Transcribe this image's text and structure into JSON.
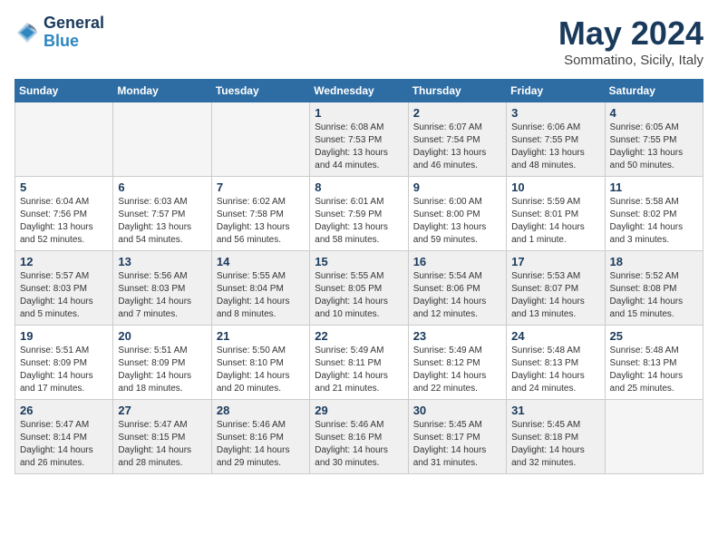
{
  "logo": {
    "line1": "General",
    "line2": "Blue"
  },
  "title": "May 2024",
  "subtitle": "Sommatino, Sicily, Italy",
  "days_of_week": [
    "Sunday",
    "Monday",
    "Tuesday",
    "Wednesday",
    "Thursday",
    "Friday",
    "Saturday"
  ],
  "weeks": [
    [
      {
        "day": "",
        "empty": true
      },
      {
        "day": "",
        "empty": true
      },
      {
        "day": "",
        "empty": true
      },
      {
        "day": "1",
        "sunrise": "6:08 AM",
        "sunset": "7:53 PM",
        "daylight": "13 hours and 44 minutes."
      },
      {
        "day": "2",
        "sunrise": "6:07 AM",
        "sunset": "7:54 PM",
        "daylight": "13 hours and 46 minutes."
      },
      {
        "day": "3",
        "sunrise": "6:06 AM",
        "sunset": "7:55 PM",
        "daylight": "13 hours and 48 minutes."
      },
      {
        "day": "4",
        "sunrise": "6:05 AM",
        "sunset": "7:55 PM",
        "daylight": "13 hours and 50 minutes."
      }
    ],
    [
      {
        "day": "5",
        "sunrise": "6:04 AM",
        "sunset": "7:56 PM",
        "daylight": "13 hours and 52 minutes."
      },
      {
        "day": "6",
        "sunrise": "6:03 AM",
        "sunset": "7:57 PM",
        "daylight": "13 hours and 54 minutes."
      },
      {
        "day": "7",
        "sunrise": "6:02 AM",
        "sunset": "7:58 PM",
        "daylight": "13 hours and 56 minutes."
      },
      {
        "day": "8",
        "sunrise": "6:01 AM",
        "sunset": "7:59 PM",
        "daylight": "13 hours and 58 minutes."
      },
      {
        "day": "9",
        "sunrise": "6:00 AM",
        "sunset": "8:00 PM",
        "daylight": "13 hours and 59 minutes."
      },
      {
        "day": "10",
        "sunrise": "5:59 AM",
        "sunset": "8:01 PM",
        "daylight": "14 hours and 1 minute."
      },
      {
        "day": "11",
        "sunrise": "5:58 AM",
        "sunset": "8:02 PM",
        "daylight": "14 hours and 3 minutes."
      }
    ],
    [
      {
        "day": "12",
        "sunrise": "5:57 AM",
        "sunset": "8:03 PM",
        "daylight": "14 hours and 5 minutes."
      },
      {
        "day": "13",
        "sunrise": "5:56 AM",
        "sunset": "8:03 PM",
        "daylight": "14 hours and 7 minutes."
      },
      {
        "day": "14",
        "sunrise": "5:55 AM",
        "sunset": "8:04 PM",
        "daylight": "14 hours and 8 minutes."
      },
      {
        "day": "15",
        "sunrise": "5:55 AM",
        "sunset": "8:05 PM",
        "daylight": "14 hours and 10 minutes."
      },
      {
        "day": "16",
        "sunrise": "5:54 AM",
        "sunset": "8:06 PM",
        "daylight": "14 hours and 12 minutes."
      },
      {
        "day": "17",
        "sunrise": "5:53 AM",
        "sunset": "8:07 PM",
        "daylight": "14 hours and 13 minutes."
      },
      {
        "day": "18",
        "sunrise": "5:52 AM",
        "sunset": "8:08 PM",
        "daylight": "14 hours and 15 minutes."
      }
    ],
    [
      {
        "day": "19",
        "sunrise": "5:51 AM",
        "sunset": "8:09 PM",
        "daylight": "14 hours and 17 minutes."
      },
      {
        "day": "20",
        "sunrise": "5:51 AM",
        "sunset": "8:09 PM",
        "daylight": "14 hours and 18 minutes."
      },
      {
        "day": "21",
        "sunrise": "5:50 AM",
        "sunset": "8:10 PM",
        "daylight": "14 hours and 20 minutes."
      },
      {
        "day": "22",
        "sunrise": "5:49 AM",
        "sunset": "8:11 PM",
        "daylight": "14 hours and 21 minutes."
      },
      {
        "day": "23",
        "sunrise": "5:49 AM",
        "sunset": "8:12 PM",
        "daylight": "14 hours and 22 minutes."
      },
      {
        "day": "24",
        "sunrise": "5:48 AM",
        "sunset": "8:13 PM",
        "daylight": "14 hours and 24 minutes."
      },
      {
        "day": "25",
        "sunrise": "5:48 AM",
        "sunset": "8:13 PM",
        "daylight": "14 hours and 25 minutes."
      }
    ],
    [
      {
        "day": "26",
        "sunrise": "5:47 AM",
        "sunset": "8:14 PM",
        "daylight": "14 hours and 26 minutes."
      },
      {
        "day": "27",
        "sunrise": "5:47 AM",
        "sunset": "8:15 PM",
        "daylight": "14 hours and 28 minutes."
      },
      {
        "day": "28",
        "sunrise": "5:46 AM",
        "sunset": "8:16 PM",
        "daylight": "14 hours and 29 minutes."
      },
      {
        "day": "29",
        "sunrise": "5:46 AM",
        "sunset": "8:16 PM",
        "daylight": "14 hours and 30 minutes."
      },
      {
        "day": "30",
        "sunrise": "5:45 AM",
        "sunset": "8:17 PM",
        "daylight": "14 hours and 31 minutes."
      },
      {
        "day": "31",
        "sunrise": "5:45 AM",
        "sunset": "8:18 PM",
        "daylight": "14 hours and 32 minutes."
      },
      {
        "day": "",
        "empty": true
      }
    ]
  ]
}
